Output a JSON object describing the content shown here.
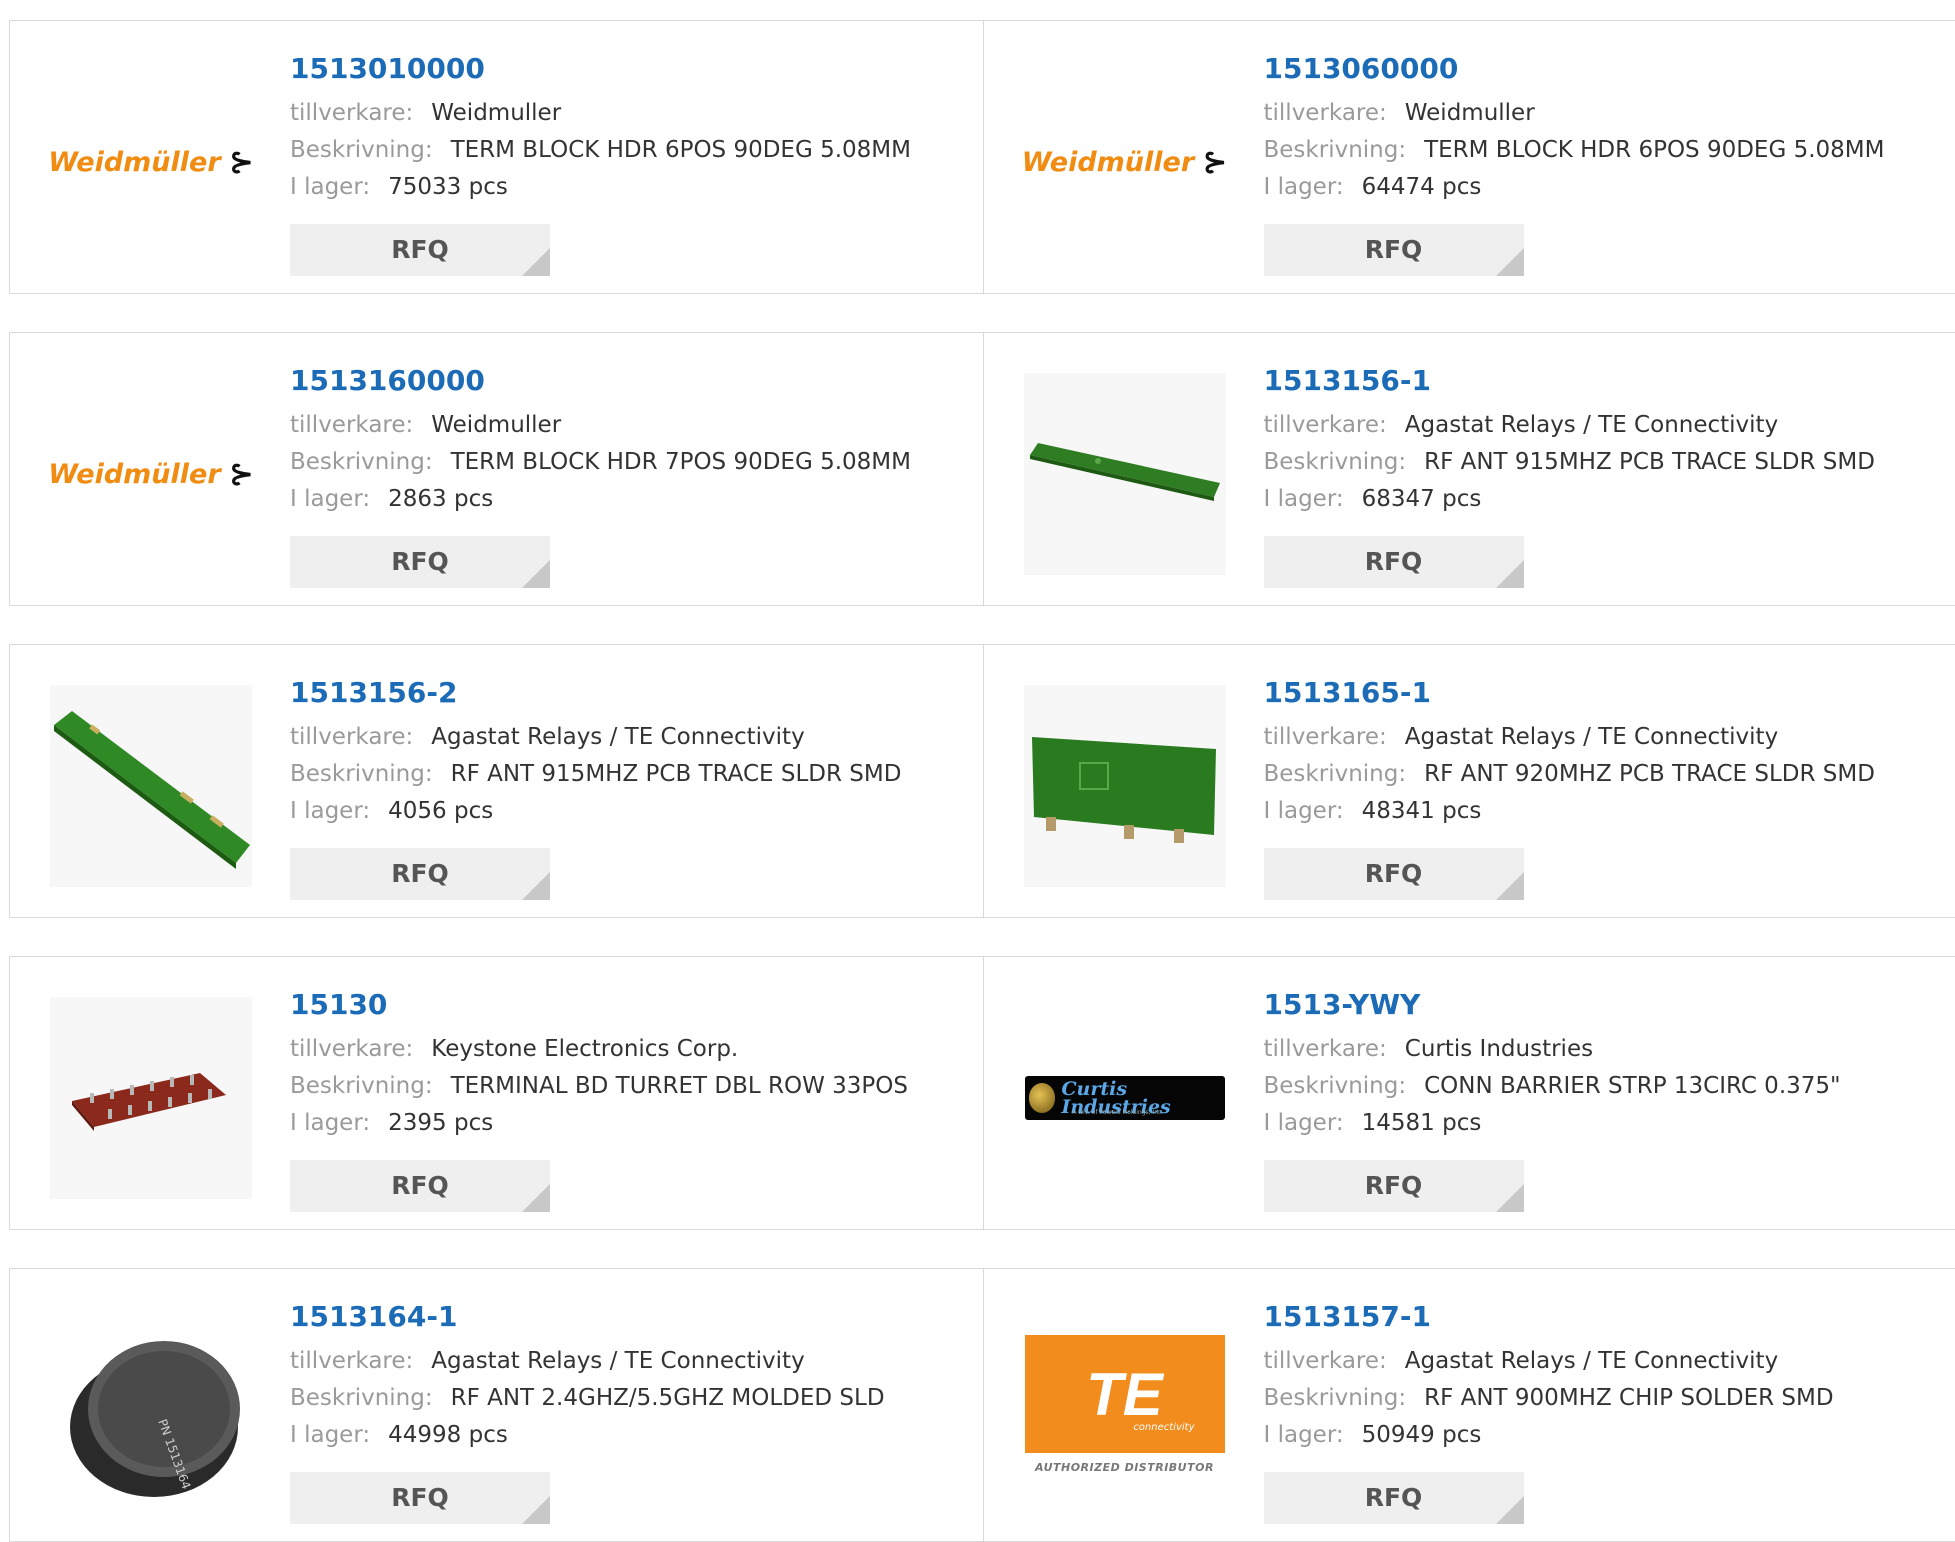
{
  "labels": {
    "manufacturer": "tillverkare:",
    "description": "Beskrivning:",
    "stock": "I lager:",
    "rfq": "RFQ"
  },
  "products": [
    {
      "pn": "1513010000",
      "manufacturer": "Weidmuller",
      "description": "TERM BLOCK HDR 6POS 90DEG 5.08MM",
      "stock": "75033 pcs",
      "image": "weidmuller-logo"
    },
    {
      "pn": "1513060000",
      "manufacturer": "Weidmuller",
      "description": "TERM BLOCK HDR 6POS 90DEG 5.08MM",
      "stock": "64474 pcs",
      "image": "weidmuller-logo"
    },
    {
      "pn": "1513160000",
      "manufacturer": "Weidmuller",
      "description": "TERM BLOCK HDR 7POS 90DEG 5.08MM",
      "stock": "2863 pcs",
      "image": "weidmuller-logo"
    },
    {
      "pn": "1513156-1",
      "manufacturer": "Agastat Relays / TE Connectivity",
      "description": "RF ANT 915MHZ PCB TRACE SLDR SMD",
      "stock": "68347 pcs",
      "image": "pcb-antenna-photo"
    },
    {
      "pn": "1513156-2",
      "manufacturer": "Agastat Relays / TE Connectivity",
      "description": "RF ANT 915MHZ PCB TRACE SLDR SMD",
      "stock": "4056 pcs",
      "image": "pcb-antenna-photo"
    },
    {
      "pn": "1513165-1",
      "manufacturer": "Agastat Relays / TE Connectivity",
      "description": "RF ANT 920MHZ PCB TRACE SLDR SMD",
      "stock": "48341 pcs",
      "image": "pcb-antenna-photo"
    },
    {
      "pn": "15130",
      "manufacturer": "Keystone Electronics Corp.",
      "description": "TERMINAL BD TURRET DBL ROW 33POS",
      "stock": "2395 pcs",
      "image": "terminal-board-photo"
    },
    {
      "pn": "1513-YWY",
      "manufacturer": "Curtis Industries",
      "description": "CONN BARRIER STRP 13CIRC 0.375\"",
      "stock": "14581 pcs",
      "image": "curtis-logo"
    },
    {
      "pn": "1513164-1",
      "manufacturer": "Agastat Relays / TE Connectivity",
      "description": "RF ANT 2.4GHZ/5.5GHZ MOLDED SLD",
      "stock": "44998 pcs",
      "image": "molded-antenna-photo"
    },
    {
      "pn": "1513157-1",
      "manufacturer": "Agastat Relays / TE Connectivity",
      "description": "RF ANT 900MHZ CHIP SOLDER SMD",
      "stock": "50949 pcs",
      "image": "te-logo"
    }
  ],
  "logos": {
    "weidmuller": "Weidmüller",
    "curtis": "Curtis Industries",
    "curtis_sub": "A Div. of Powers Holdings, Inc.",
    "te": "TE",
    "te_sub": "connectivity",
    "te_badge": "AUTHORIZED DISTRIBUTOR"
  },
  "colors": {
    "link": "#1c6bb6",
    "weidmuller_orange": "#f08c12",
    "te_orange": "#f28c1c"
  }
}
